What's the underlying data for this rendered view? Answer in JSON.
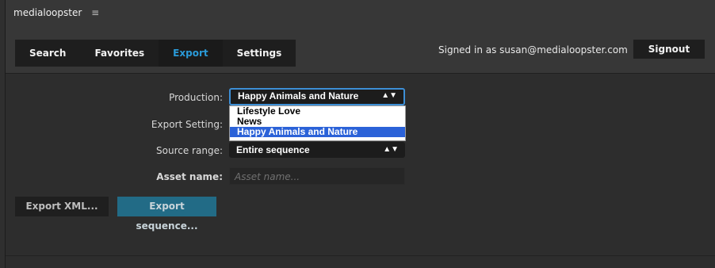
{
  "app": {
    "name": "medialoopster",
    "menu_icon": "hamburger-icon"
  },
  "tabs": [
    {
      "label": "Search",
      "active": false
    },
    {
      "label": "Favorites",
      "active": false
    },
    {
      "label": "Export",
      "active": true
    },
    {
      "label": "Settings",
      "active": false
    }
  ],
  "auth": {
    "signed_in_text": "Signed in as susan@medialoopster.com",
    "signout_label": "Signout"
  },
  "form": {
    "production": {
      "label": "Production:",
      "value": "Happy Animals and Nature"
    },
    "production_options": [
      "Lifestyle Love",
      "News",
      "Happy Animals and Nature"
    ],
    "export_setting": {
      "label": "Export Setting:"
    },
    "source_range": {
      "label": "Source range:",
      "value": "Entire sequence"
    },
    "asset_name": {
      "label": "Asset name:",
      "placeholder": "Asset name..."
    }
  },
  "buttons": {
    "export_xml": "Export XML...",
    "export_sequence": "Export sequence..."
  },
  "colors": {
    "accent": "#2a9ad8",
    "selected_option": "#2b62d8",
    "primary_button": "#226b86"
  }
}
